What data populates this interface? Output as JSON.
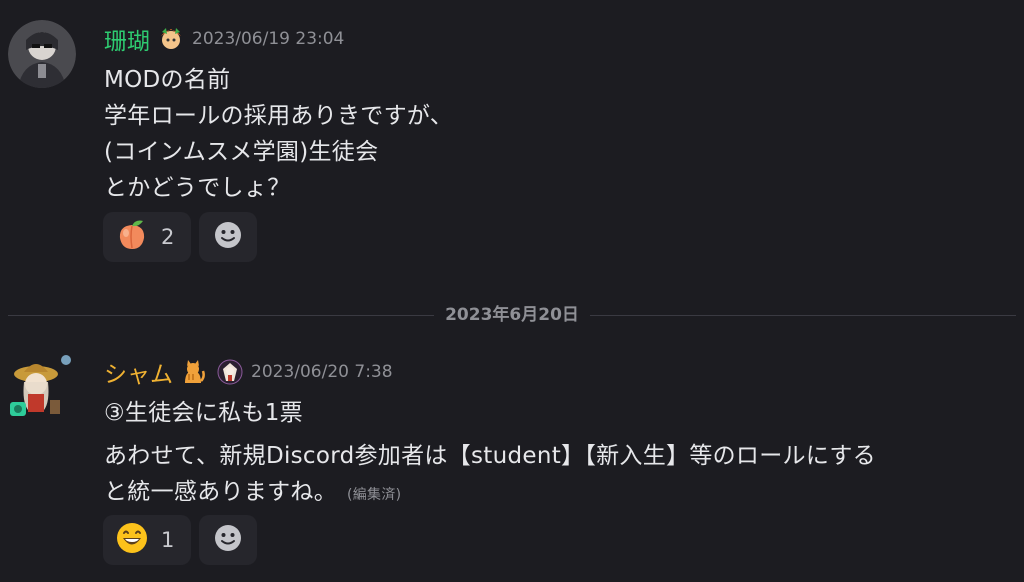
{
  "messages": [
    {
      "username": "珊瑚",
      "username_color": "#2ecc71",
      "timestamp": "2023/06/19 23:04",
      "lines": [
        "MODの名前",
        "学年ロールの採用ありきですが、",
        "(コインムスメ学園)生徒会",
        "とかどうでしょ？"
      ],
      "reactions": [
        {
          "emoji": "peach-icon",
          "count": "2"
        }
      ]
    },
    {
      "username": "シャム",
      "username_color": "#f0b232",
      "timestamp": "2023/06/20 7:38",
      "lines": [
        "③生徒会に私も1票",
        "あわせて、新規Discord参加者は【student】【新入生】等のロールにする",
        "と統一感ありますね。"
      ],
      "edited_label": "(編集済)",
      "reactions": [
        {
          "emoji": "grinning-face-icon",
          "count": "1"
        }
      ]
    }
  ],
  "date_divider": "2023年6月20日",
  "colors": {
    "background": "#1c1c21",
    "reaction_bg": "#26262c",
    "muted": "#8f9096"
  }
}
